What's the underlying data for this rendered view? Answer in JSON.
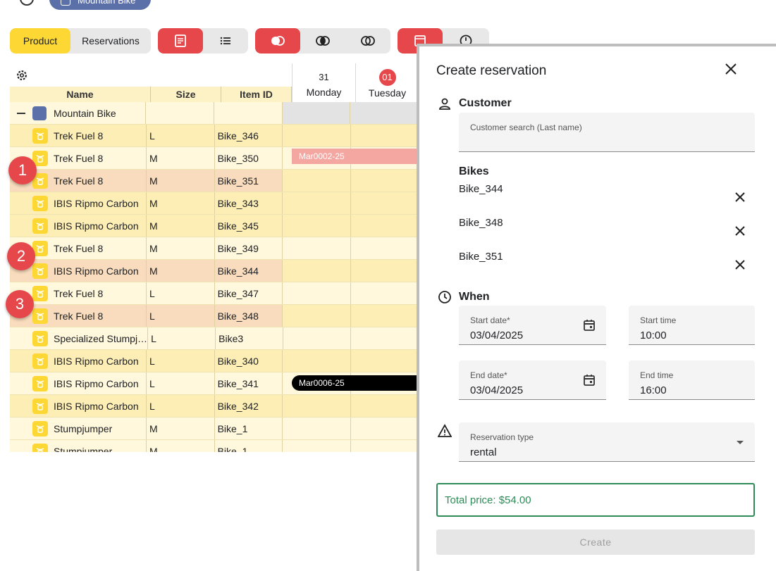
{
  "top": {
    "chip_label": "Mountain Bike"
  },
  "toolbar": {
    "product_label": "Product",
    "reservations_label": "Reservations"
  },
  "grid": {
    "headers": {
      "name": "Name",
      "size": "Size",
      "item_id": "Item ID"
    },
    "days": [
      {
        "num": "31",
        "name": "Monday"
      },
      {
        "num": "01",
        "name": "Tuesday"
      }
    ],
    "group": {
      "name": "Mountain Bike"
    },
    "rows": [
      {
        "name": "Trek Fuel 8",
        "size": "L",
        "id": "Bike_346"
      },
      {
        "name": "Trek Fuel 8",
        "size": "M",
        "id": "Bike_350"
      },
      {
        "name": "Trek Fuel 8",
        "size": "M",
        "id": "Bike_351"
      },
      {
        "name": "IBIS Ripmo Carbon",
        "size": "M",
        "id": "Bike_343"
      },
      {
        "name": "IBIS Ripmo Carbon",
        "size": "M",
        "id": "Bike_345"
      },
      {
        "name": "Trek Fuel 8",
        "size": "M",
        "id": "Bike_349"
      },
      {
        "name": "IBIS Ripmo Carbon",
        "size": "M",
        "id": "Bike_344"
      },
      {
        "name": "Trek Fuel 8",
        "size": "L",
        "id": "Bike_347"
      },
      {
        "name": "Trek Fuel 8",
        "size": "L",
        "id": "Bike_348"
      },
      {
        "name": "Specialized Stumpj…",
        "size": "L",
        "id": "Bike3"
      },
      {
        "name": "IBIS Ripmo Carbon",
        "size": "L",
        "id": "Bike_340"
      },
      {
        "name": "IBIS Ripmo Carbon",
        "size": "L",
        "id": "Bike_341"
      },
      {
        "name": "IBIS Ripmo Carbon",
        "size": "L",
        "id": "Bike_342"
      },
      {
        "name": "Stumpjumper",
        "size": "M",
        "id": "Bike_1"
      },
      {
        "name": "Stumpjumper",
        "size": "M",
        "id": "Bike_1"
      }
    ],
    "reservations": {
      "pink": "Mar0002-25",
      "black": "Mar0006-25"
    }
  },
  "markers": [
    "1",
    "2",
    "3"
  ],
  "dialog": {
    "title": "Create reservation",
    "customer_label": "Customer",
    "customer_search_label": "Customer search (Last name)",
    "bikes_label": "Bikes",
    "bikes": [
      "Bike_344",
      "Bike_348",
      "Bike_351"
    ],
    "when_label": "When",
    "start_date_label": "Start date*",
    "start_date": "03/04/2025",
    "start_time_label": "Start time",
    "start_time": "10:00",
    "end_date_label": "End date*",
    "end_date": "03/04/2025",
    "end_time_label": "End time",
    "end_time": "16:00",
    "reservation_type_label": "Reservation type",
    "reservation_type": "rental",
    "total_price": "Total price: $54.00",
    "create_label": "Create"
  }
}
